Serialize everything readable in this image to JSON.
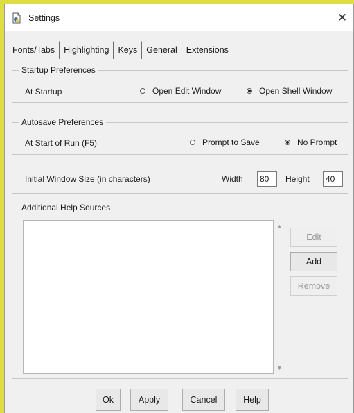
{
  "window": {
    "title": "Settings",
    "close_glyph": "✕"
  },
  "tabs": [
    "Fonts/Tabs",
    "Highlighting",
    "Keys",
    "General",
    "Extensions"
  ],
  "startup": {
    "legend": "Startup Preferences",
    "label": "At Startup",
    "options": [
      {
        "label": "Open Edit Window",
        "selected": false
      },
      {
        "label": "Open Shell Window",
        "selected": true
      }
    ]
  },
  "autosave": {
    "legend": "Autosave Preferences",
    "label": "At Start of Run (F5)",
    "options": [
      {
        "label": "Prompt to Save",
        "selected": false
      },
      {
        "label": "No Prompt",
        "selected": true
      }
    ]
  },
  "window_size": {
    "label": "Initial Window Size  (in characters)",
    "width_label": "Width",
    "width_value": "80",
    "height_label": "Height",
    "height_value": "40"
  },
  "help_sources": {
    "legend": "Additional Help Sources",
    "buttons": {
      "edit": "Edit",
      "add": "Add",
      "remove": "Remove"
    }
  },
  "footer": {
    "ok": "Ok",
    "apply": "Apply",
    "cancel": "Cancel",
    "help": "Help"
  },
  "icons": {
    "title": "python-idle-icon",
    "scroll_up": "scroll-up-arrow-icon",
    "scroll_down": "scroll-down-arrow-icon"
  }
}
